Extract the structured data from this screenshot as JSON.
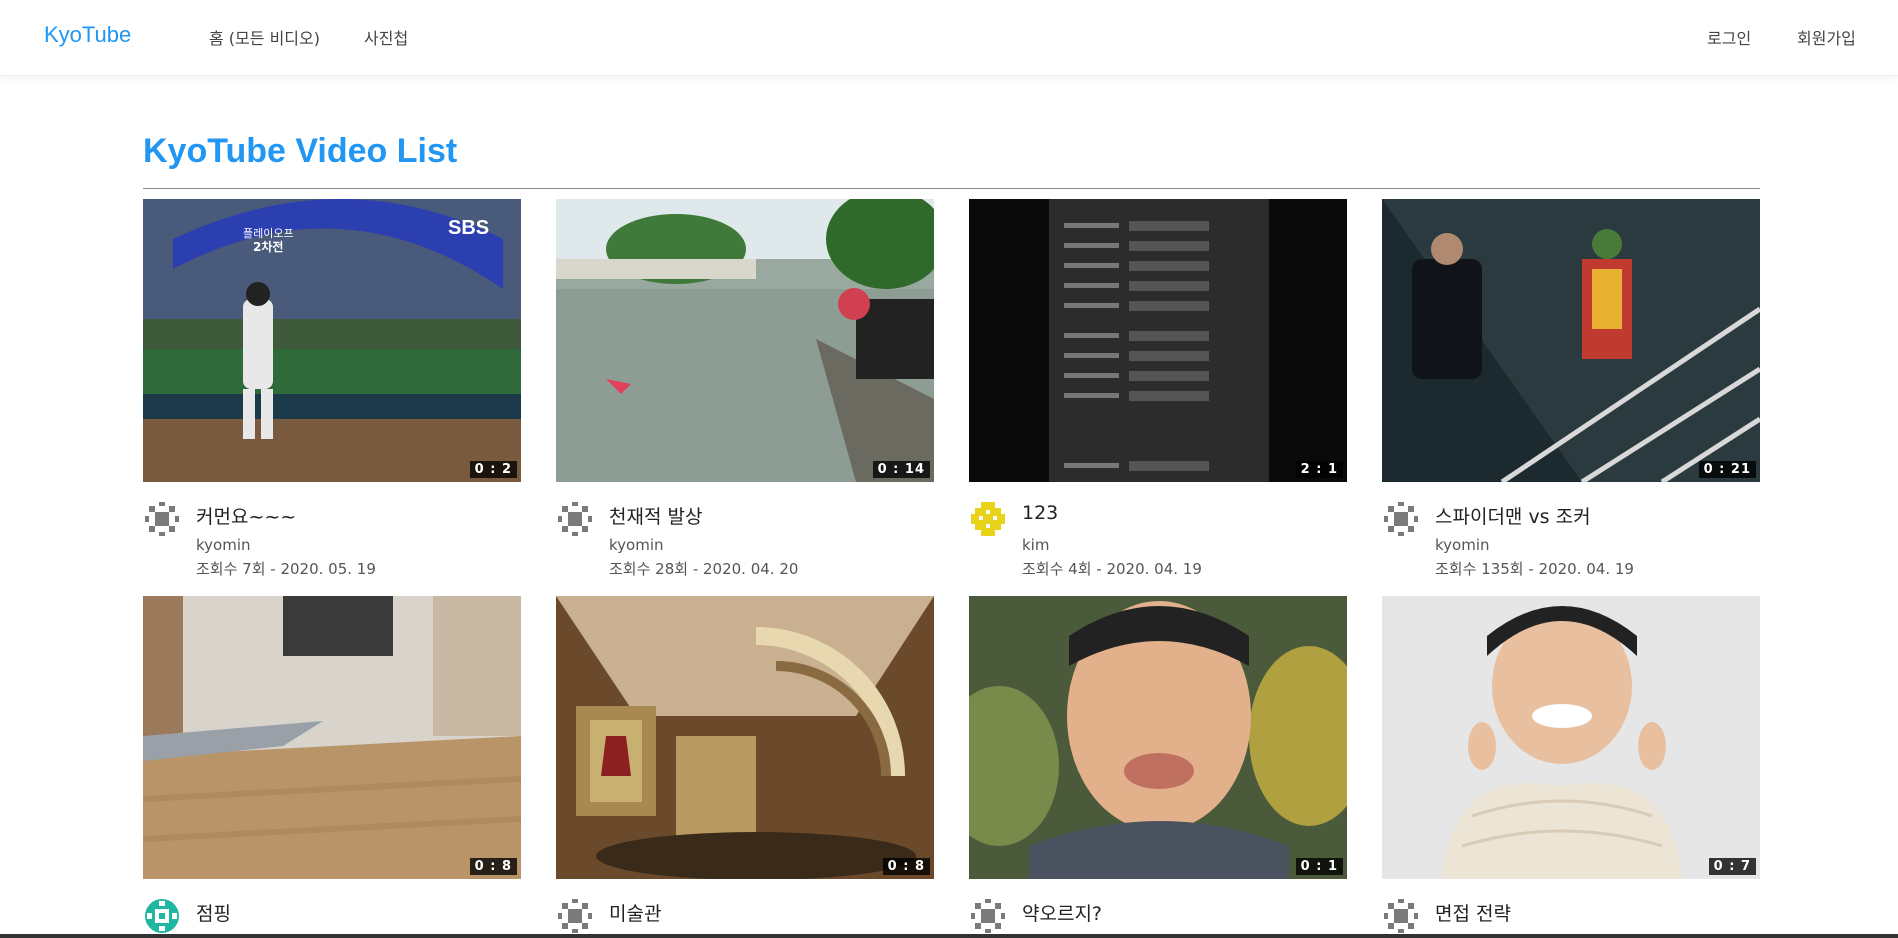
{
  "nav": {
    "brand": "KyoTube",
    "home": "홈 (모든 비디오)",
    "photos": "사진첩",
    "login": "로그인",
    "signup": "회원가입"
  },
  "page": {
    "heading": "KyoTube Video List"
  },
  "videos": [
    {
      "title": "커먼요~~~",
      "author": "kyomin",
      "meta": "조회수 7회 - 2020. 05. 19",
      "duration": "0 : 2",
      "avatar_color": "#7a7a7a"
    },
    {
      "title": "천재적 발상",
      "author": "kyomin",
      "meta": "조회수 28회 - 2020. 04. 20",
      "duration": "0 : 14",
      "avatar_color": "#7a7a7a"
    },
    {
      "title": "123",
      "author": "kim",
      "meta": "조회수 4회 - 2020. 04. 19",
      "duration": "2 : 1",
      "avatar_color": "#e8d31a"
    },
    {
      "title": "스파이더맨 vs 조커",
      "author": "kyomin",
      "meta": "조회수 135회 - 2020. 04. 19",
      "duration": "0 : 21",
      "avatar_color": "#7a7a7a"
    },
    {
      "title": "점핑",
      "author": "",
      "meta": "",
      "duration": "0 : 8",
      "avatar_color": "#1fb7a0"
    },
    {
      "title": "미술관",
      "author": "",
      "meta": "",
      "duration": "0 : 8",
      "avatar_color": "#7a7a7a"
    },
    {
      "title": "약오르지?",
      "author": "",
      "meta": "",
      "duration": "0 : 1",
      "avatar_color": "#7a7a7a"
    },
    {
      "title": "면접 전략",
      "author": "",
      "meta": "",
      "duration": "0 : 7",
      "avatar_color": "#7a7a7a"
    }
  ]
}
